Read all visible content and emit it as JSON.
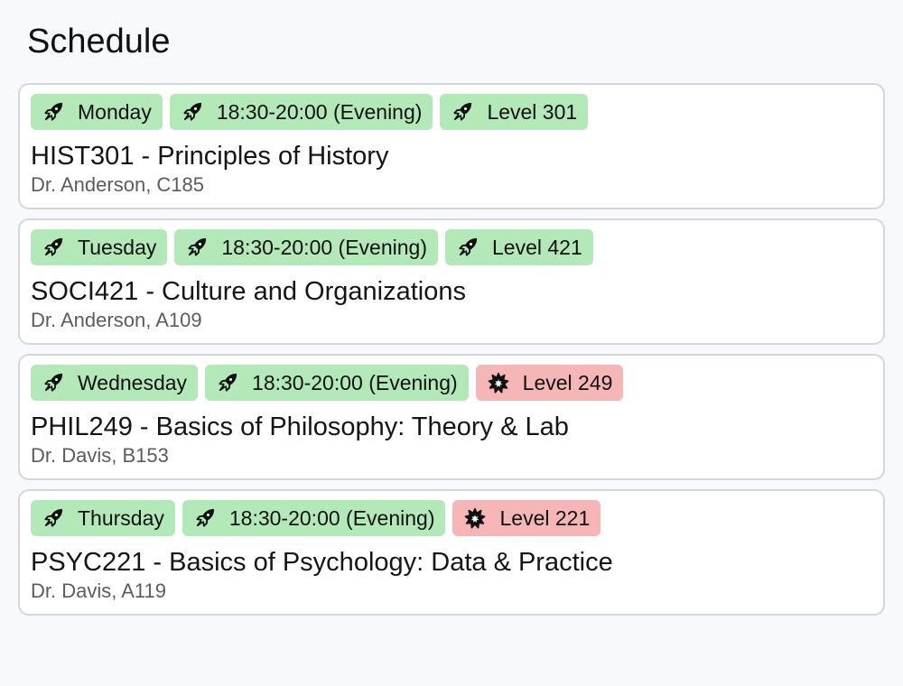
{
  "page": {
    "title": "Schedule"
  },
  "colors": {
    "tag_ok": "#b3e8b8",
    "tag_warn": "#f6b6b8",
    "card_border": "#d4d6dc",
    "background": "#f8f9fd"
  },
  "courses": [
    {
      "title": "HIST301 - Principles of History",
      "meta": "Dr. Anderson, C185",
      "tags": [
        {
          "label": "Monday",
          "icon": "rocket-icon",
          "status": "ok"
        },
        {
          "label": "18:30-20:00 (Evening)",
          "icon": "rocket-icon",
          "status": "ok"
        },
        {
          "label": "Level 301",
          "icon": "rocket-icon",
          "status": "ok"
        }
      ]
    },
    {
      "title": "SOCI421 - Culture and Organizations",
      "meta": "Dr. Anderson, A109",
      "tags": [
        {
          "label": "Tuesday",
          "icon": "rocket-icon",
          "status": "ok"
        },
        {
          "label": "18:30-20:00 (Evening)",
          "icon": "rocket-icon",
          "status": "ok"
        },
        {
          "label": "Level 421",
          "icon": "rocket-icon",
          "status": "ok"
        }
      ]
    },
    {
      "title": "PHIL249 - Basics of Philosophy: Theory & Lab",
      "meta": "Dr. Davis, B153",
      "tags": [
        {
          "label": "Wednesday",
          "icon": "rocket-icon",
          "status": "ok"
        },
        {
          "label": "18:30-20:00 (Evening)",
          "icon": "rocket-icon",
          "status": "ok"
        },
        {
          "label": "Level 249",
          "icon": "explosion-icon",
          "status": "warn"
        }
      ]
    },
    {
      "title": "PSYC221 - Basics of Psychology: Data & Practice",
      "meta": "Dr. Davis, A119",
      "tags": [
        {
          "label": "Thursday",
          "icon": "rocket-icon",
          "status": "ok"
        },
        {
          "label": "18:30-20:00 (Evening)",
          "icon": "rocket-icon",
          "status": "ok"
        },
        {
          "label": "Level 221",
          "icon": "explosion-icon",
          "status": "warn"
        }
      ]
    }
  ]
}
